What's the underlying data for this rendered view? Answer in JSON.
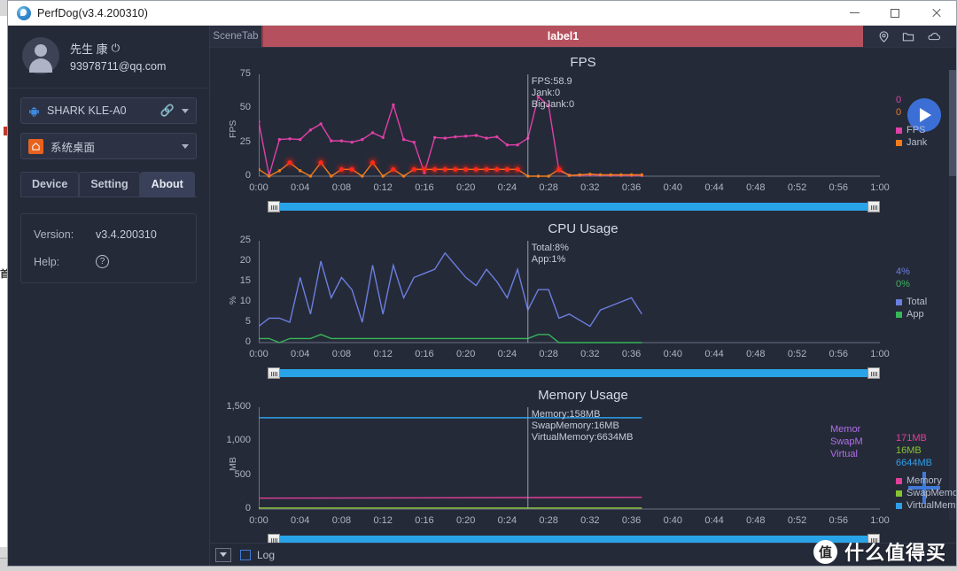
{
  "window": {
    "title": "PerfDog(v3.4.200310)",
    "logo_icon": "perfdog-logo",
    "minimize_label": "–",
    "maximize_label": "□",
    "close_label": "×"
  },
  "background_window": {
    "text": "首"
  },
  "sidebar": {
    "user": {
      "name": "先生 康",
      "power_icon": "⏻",
      "email": "93978711@qq.com",
      "avatar_icon": "user-avatar-icon"
    },
    "device_select": {
      "label": "SHARK KLE-A0",
      "device_icon": "android-icon",
      "link_icon": "link-icon",
      "caret_icon": "chevron-down-icon"
    },
    "app_select": {
      "label": "系统桌面",
      "app_icon": "home-icon",
      "caret_icon": "chevron-down-icon"
    },
    "tabs": [
      {
        "label": "Device",
        "active": false
      },
      {
        "label": "Setting",
        "active": false
      },
      {
        "label": "About",
        "active": true
      }
    ],
    "about": {
      "version_key": "Version:",
      "version_value": "v3.4.200310",
      "help_key": "Help:",
      "help_icon": "question-mark-icon"
    }
  },
  "scenebar": {
    "scene_tab_label": "SceneTab",
    "label_tab": "label1",
    "label_tab_color": "#b5515e",
    "tools": [
      {
        "name": "location-pin-icon"
      },
      {
        "name": "folder-icon"
      },
      {
        "name": "cloud-icon"
      }
    ]
  },
  "controls": {
    "play_button_label": "play",
    "add_button_label": "+",
    "bottom_dropdown_label": "collapse",
    "log_checkbox_label": "Log",
    "log_checked": false
  },
  "watermark": {
    "logo": "值",
    "text": "什么值得买"
  },
  "chart_data": [
    {
      "type": "line",
      "id": "fps",
      "title": "FPS",
      "ylabel": "FPS",
      "xlabel": "",
      "ylim": [
        0,
        75
      ],
      "yticks": [
        0,
        25,
        50,
        75
      ],
      "xticks": [
        "0:00",
        "0:04",
        "0:08",
        "0:12",
        "0:16",
        "0:20",
        "0:24",
        "0:28",
        "0:32",
        "0:36",
        "0:40",
        "0:44",
        "0:48",
        "0:52",
        "0:56",
        "1:00"
      ],
      "xlim_seconds": [
        0,
        60
      ],
      "grid": false,
      "legend_position": "right",
      "cursor": {
        "x_seconds": 26,
        "lines": [
          "FPS:58.9",
          "Jank:0",
          "BigJank:0"
        ]
      },
      "legend_values": [
        {
          "text": "0",
          "color": "#e040a8"
        },
        {
          "text": "0",
          "color": "#f07c1e"
        }
      ],
      "series": [
        {
          "name": "FPS",
          "color": "#e040a8",
          "x": [
            0,
            1,
            2,
            3,
            4,
            5,
            6,
            7,
            8,
            9,
            10,
            11,
            12,
            13,
            14,
            15,
            16,
            17,
            18,
            19,
            20,
            21,
            22,
            23,
            24,
            25,
            26,
            27,
            28,
            29,
            30,
            31,
            32,
            33,
            34,
            35,
            36,
            37
          ],
          "values": [
            40,
            0.5,
            27,
            27.5,
            27,
            34,
            38.5,
            26,
            26,
            25,
            27,
            32,
            28.5,
            52.5,
            27,
            25,
            2.5,
            28.5,
            28,
            29,
            29.5,
            30,
            28,
            29,
            23,
            23,
            28,
            58.5,
            52,
            4,
            0.8,
            0.6,
            1,
            0.7,
            0.6,
            0.6,
            0.6,
            0.5
          ]
        },
        {
          "name": "Jank",
          "color": "#f07c1e",
          "x": [
            0,
            1,
            2,
            3,
            4,
            5,
            6,
            7,
            8,
            9,
            10,
            11,
            12,
            13,
            14,
            15,
            16,
            17,
            18,
            19,
            20,
            21,
            22,
            23,
            24,
            25,
            26,
            27,
            28,
            29,
            30,
            31,
            32,
            33,
            34,
            35,
            36,
            37
          ],
          "values": [
            5,
            0,
            4,
            10,
            4,
            0,
            10,
            0,
            5,
            5,
            0,
            10,
            0,
            5,
            0,
            5,
            5,
            5,
            5,
            5,
            5,
            5,
            5,
            5,
            5,
            5,
            0,
            0,
            0,
            5,
            0.5,
            1,
            1.5,
            1,
            1,
            1,
            1,
            1
          ]
        }
      ],
      "glow_points_x": [
        3,
        6,
        8,
        9,
        11,
        13,
        15,
        16,
        17,
        18,
        19,
        20,
        21,
        22,
        23,
        24,
        25,
        29
      ]
    },
    {
      "type": "line",
      "id": "cpu",
      "title": "CPU Usage",
      "ylabel": "%",
      "xlabel": "",
      "ylim": [
        0,
        25
      ],
      "yticks": [
        0,
        5,
        10,
        15,
        20,
        25
      ],
      "xticks": [
        "0:00",
        "0:04",
        "0:08",
        "0:12",
        "0:16",
        "0:20",
        "0:24",
        "0:28",
        "0:32",
        "0:36",
        "0:40",
        "0:44",
        "0:48",
        "0:52",
        "0:56",
        "1:00"
      ],
      "xlim_seconds": [
        0,
        60
      ],
      "grid": false,
      "legend_position": "right",
      "cursor": {
        "x_seconds": 26,
        "lines": [
          "Total:8%",
          "App:1%"
        ]
      },
      "legend_values": [
        {
          "text": "4%",
          "color": "#6b7fe0"
        },
        {
          "text": "0%",
          "color": "#37b65a"
        }
      ],
      "series": [
        {
          "name": "Total",
          "color": "#6b7fe0",
          "x": [
            0,
            1,
            2,
            3,
            4,
            5,
            6,
            7,
            8,
            9,
            10,
            11,
            12,
            13,
            14,
            15,
            16,
            17,
            18,
            19,
            20,
            21,
            22,
            23,
            24,
            25,
            26,
            27,
            28,
            29,
            30,
            31,
            32,
            33,
            34,
            35,
            36,
            37
          ],
          "values": [
            4,
            6,
            6,
            5,
            16,
            7,
            20,
            11,
            16,
            13,
            5,
            19,
            7,
            19,
            11,
            16,
            17,
            18,
            22,
            19,
            16,
            14,
            18,
            15,
            11,
            18,
            8,
            13,
            13,
            6,
            7,
            5.5,
            4,
            8,
            9,
            10,
            11,
            7
          ]
        },
        {
          "name": "App",
          "color": "#37b65a",
          "x": [
            0,
            1,
            2,
            3,
            4,
            5,
            6,
            7,
            8,
            9,
            10,
            11,
            12,
            13,
            14,
            15,
            16,
            17,
            18,
            19,
            20,
            21,
            22,
            23,
            24,
            25,
            26,
            27,
            28,
            29,
            30,
            31,
            32,
            33,
            34,
            35,
            36,
            37
          ],
          "values": [
            1,
            1,
            0,
            1,
            1,
            1,
            2,
            1,
            1,
            1,
            1,
            1,
            1,
            1,
            1,
            1,
            1,
            1,
            1,
            1,
            1,
            1,
            1,
            1,
            1,
            1,
            1,
            2,
            2,
            0,
            0,
            0,
            0,
            0,
            0,
            0,
            0,
            0
          ]
        }
      ]
    },
    {
      "type": "line",
      "id": "memory",
      "title": "Memory Usage",
      "ylabel": "MB",
      "xlabel": "",
      "ylim": [
        0,
        1500
      ],
      "yticks": [
        0,
        500,
        1000,
        1500
      ],
      "ytick_labels": [
        "0",
        "500",
        "1,000",
        "1,500"
      ],
      "xticks": [
        "0:00",
        "0:04",
        "0:08",
        "0:12",
        "0:16",
        "0:20",
        "0:24",
        "0:28",
        "0:32",
        "0:36",
        "0:40",
        "0:44",
        "0:48",
        "0:52",
        "0:56",
        "1:00"
      ],
      "xlim_seconds": [
        0,
        60
      ],
      "grid": false,
      "legend_position": "right",
      "cursor": {
        "x_seconds": 26,
        "lines": [
          "Memory:158MB",
          "SwapMemory:16MB",
          "VirtualMemory:6634MB"
        ]
      },
      "legend_left_labels": [
        {
          "text": "Memor",
          "color": "#b06fe8"
        },
        {
          "text": "SwapM",
          "color": "#b06fe8"
        },
        {
          "text": "Virtual",
          "color": "#b06fe8"
        }
      ],
      "legend_values": [
        {
          "text": "171MB",
          "color": "#e0409a"
        },
        {
          "text": "16MB",
          "color": "#86c232"
        },
        {
          "text": "6644MB",
          "color": "#2f9fe8"
        }
      ],
      "series": [
        {
          "name": "Memory",
          "color": "#e0409a",
          "x": [
            0,
            37
          ],
          "values": [
            160,
            172
          ]
        },
        {
          "name": "SwapMemory",
          "color": "#86c232",
          "x": [
            0,
            37
          ],
          "values": [
            16,
            16
          ]
        },
        {
          "name": "VirtualMem...",
          "color": "#2f9fe8",
          "x": [
            0,
            37
          ],
          "values": [
            1345,
            1345
          ]
        }
      ]
    }
  ]
}
